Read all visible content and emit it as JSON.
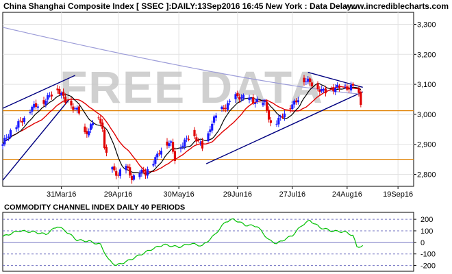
{
  "header": {
    "title": "China Shanghai Composite Index [ SSEC ]:DAILY:13Sep2016 16:45 New York : Data Delay..",
    "site": "www.incrediblecharts.com"
  },
  "watermark": "FREE DATA",
  "indicator": {
    "title": "COMMODITY CHANNEL INDEX DAILY 40 PERIODS"
  },
  "colors": {
    "background": "#ffffff",
    "up_candle": "#1a1aff",
    "down_candle": "#e00000",
    "ma_fast": "#000000",
    "ma_mid": "#e00000",
    "ma_slow": "#9c9cd8",
    "trendline": "#000080",
    "horizontal_line": "#e08000",
    "cci_line": "#00c000",
    "cci_bands": "#7070c0"
  },
  "chart_data": [
    {
      "type": "candlestick",
      "title": "China Shanghai Composite Index [ SSEC ]:DAILY:13Sep2016 16:45 New York : Data Delay..",
      "x_tick_labels": [
        "31Mar16",
        "29Apr16",
        "30May16",
        "29Jun16",
        "27Jul16",
        "24Aug16",
        "19Sep16"
      ],
      "x_tick_days": [
        30,
        59,
        90,
        120,
        148,
        176,
        202
      ],
      "y_tick_labels": [
        "2,800",
        "2,900",
        "3,000",
        "3,100",
        "3,200",
        "3,300"
      ],
      "y_tick_values": [
        2800,
        2900,
        3000,
        3100,
        3200,
        3300
      ],
      "ylim": [
        2760,
        3340
      ],
      "horizontal_lines": [
        3012,
        2850
      ],
      "price_anchors": [
        [
          0,
          2900
        ],
        [
          8,
          2975
        ],
        [
          14,
          3010
        ],
        [
          20,
          3045
        ],
        [
          25,
          3065
        ],
        [
          28,
          3080
        ],
        [
          31,
          3060
        ],
        [
          35,
          3030
        ],
        [
          39,
          3000
        ],
        [
          42,
          2935
        ],
        [
          45,
          2965
        ],
        [
          48,
          2985
        ],
        [
          51,
          2955
        ],
        [
          52,
          2880
        ],
        [
          55,
          2830
        ],
        [
          59,
          2800
        ],
        [
          63,
          2820
        ],
        [
          66,
          2790
        ],
        [
          70,
          2810
        ],
        [
          73,
          2800
        ],
        [
          76,
          2830
        ],
        [
          80,
          2880
        ],
        [
          83,
          2905
        ],
        [
          86,
          2895
        ],
        [
          88,
          2850
        ],
        [
          91,
          2900
        ],
        [
          94,
          2920
        ],
        [
          97,
          2930
        ],
        [
          100,
          2905
        ],
        [
          103,
          2890
        ],
        [
          106,
          2960
        ],
        [
          110,
          3000
        ],
        [
          114,
          3030
        ],
        [
          118,
          3060
        ],
        [
          122,
          3050
        ],
        [
          126,
          3055
        ],
        [
          130,
          3045
        ],
        [
          134,
          3030
        ],
        [
          137,
          2970
        ],
        [
          140,
          2980
        ],
        [
          144,
          3000
        ],
        [
          148,
          3030
        ],
        [
          151,
          3060
        ],
        [
          153,
          3120
        ],
        [
          157,
          3100
        ],
        [
          161,
          3090
        ],
        [
          165,
          3080
        ],
        [
          169,
          3080
        ],
        [
          172,
          3090
        ],
        [
          175,
          3095
        ],
        [
          178,
          3090
        ],
        [
          181,
          3085
        ],
        [
          183,
          3030
        ]
      ],
      "moving_averages": {
        "fast_period": 10,
        "mid_period": 21,
        "slow_period": 100,
        "slow_start": 3290,
        "slow_end": 3068
      },
      "trendlines": [
        {
          "from": [
            0,
            2780
          ],
          "to": [
            34,
            3050
          ]
        },
        {
          "from": [
            0,
            3020
          ],
          "to": [
            37,
            3130
          ]
        },
        {
          "from": [
            104,
            2835
          ],
          "to": [
            184,
            3075
          ]
        },
        {
          "from": [
            156,
            3140
          ],
          "to": [
            184,
            3090
          ]
        }
      ]
    },
    {
      "type": "line",
      "title": "COMMODITY CHANNEL INDEX DAILY 40 PERIODS",
      "y_tick_labels": [
        "200",
        "100",
        "0",
        "-100",
        "-200"
      ],
      "y_tick_values": [
        200,
        100,
        0,
        -100,
        -200
      ],
      "ylim": [
        -250,
        260
      ],
      "bands": [
        200,
        100,
        0,
        -100,
        -200
      ],
      "series": [
        {
          "values_anchors": [
            [
              0,
              50
            ],
            [
              8,
              100
            ],
            [
              16,
              90
            ],
            [
              22,
              70
            ],
            [
              28,
              140
            ],
            [
              32,
              100
            ],
            [
              38,
              20
            ],
            [
              44,
              10
            ],
            [
              50,
              -20
            ],
            [
              54,
              -150
            ],
            [
              58,
              -200
            ],
            [
              64,
              -160
            ],
            [
              70,
              -110
            ],
            [
              76,
              -60
            ],
            [
              82,
              -20
            ],
            [
              90,
              -40
            ],
            [
              96,
              -10
            ],
            [
              102,
              -30
            ],
            [
              108,
              60
            ],
            [
              114,
              180
            ],
            [
              118,
              200
            ],
            [
              124,
              150
            ],
            [
              130,
              140
            ],
            [
              136,
              20
            ],
            [
              140,
              -10
            ],
            [
              148,
              60
            ],
            [
              153,
              150
            ],
            [
              157,
              190
            ],
            [
              162,
              130
            ],
            [
              168,
              100
            ],
            [
              175,
              90
            ],
            [
              179,
              60
            ],
            [
              181,
              -40
            ],
            [
              184,
              -30
            ]
          ]
        }
      ]
    }
  ]
}
